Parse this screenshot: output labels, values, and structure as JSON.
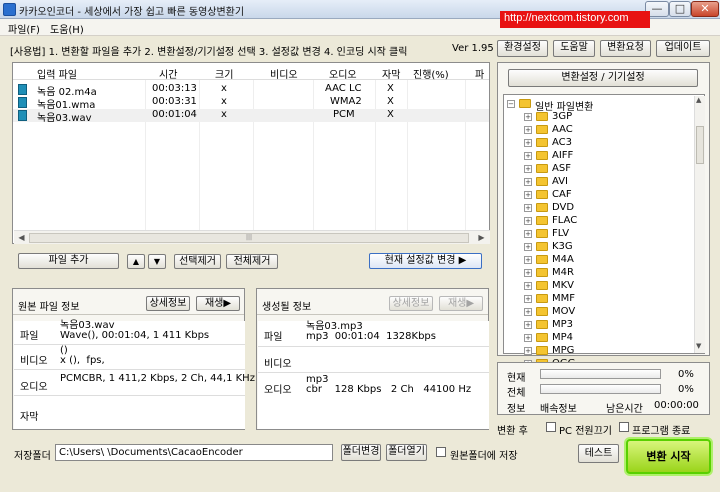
{
  "window": {
    "title": "카카오인코더 - 세상에서 가장 쉽고 빠른 동영상변환기",
    "watermark": "http://nextcom.tistory.com",
    "min": "—",
    "max": "□",
    "close": "✕"
  },
  "menu": [
    "파일(F)",
    "도움(H)"
  ],
  "instructions": "[사용법] 1. 변환할 파일을 추가   2. 변환설정/기기설정 선택   3. 설정값 변경   4. 인코딩 시작 클릭",
  "version": "Ver 1.95",
  "top_buttons": [
    "환경설정",
    "도움말",
    "변환요청",
    "업데이트"
  ],
  "file_table": {
    "columns": [
      "입력 파일",
      "시간",
      "크기",
      "비디오",
      "오디오",
      "자막",
      "진행(%)",
      "파"
    ],
    "rows": [
      {
        "name": "녹음 02.m4a",
        "time": "00:03:13",
        "size": "x",
        "video": "",
        "audio": "AAC LC",
        "sub": "X",
        "progress": ""
      },
      {
        "name": "녹음01.wma",
        "time": "00:03:31",
        "size": "x",
        "video": "",
        "audio": "WMA2",
        "sub": "X",
        "progress": ""
      },
      {
        "name": "녹음03.wav",
        "time": "00:01:04",
        "size": "x",
        "video": "",
        "audio": "PCM",
        "sub": "X",
        "progress": ""
      }
    ]
  },
  "file_buttons": {
    "add": "파일 추가",
    "up": "▲",
    "down": "▼",
    "remove_selected": "선택제거",
    "remove_all": "전체제거",
    "change_settings": "현재 설정값 변경 ▶"
  },
  "source_info": {
    "title": "원본 파일 정보",
    "detail": "상세정보",
    "play": "재생▶",
    "labels": [
      "파일",
      "비디오",
      "오디오",
      "자막"
    ],
    "file": "녹음03.wav\nWave(), 00:01:04, 1 411 Kbps",
    "video": "()\nx (),  fps,",
    "audio": "PCMCBR, 1 411,2 Kbps, 2 Ch, 44,1 KHz",
    "sub": ""
  },
  "output_info": {
    "title": "생성될 정보",
    "detail": "상세정보",
    "play": "재생▶",
    "labels": [
      "파일",
      "비디오",
      "오디오"
    ],
    "file": "녹음03.mp3\nmp3  00:01:04  1328Kbps",
    "video": "",
    "audio": "mp3\ncbr    128 Kbps   2 Ch   44100 Hz"
  },
  "tree": {
    "title": "변환설정 / 기기설정",
    "root": "일반 파일변환",
    "items": [
      "3GP",
      "AAC",
      "AC3",
      "AIFF",
      "ASF",
      "AVI",
      "CAF",
      "DVD",
      "FLAC",
      "FLV",
      "K3G",
      "M4A",
      "M4R",
      "MKV",
      "MMF",
      "MOV",
      "MP3",
      "MP4",
      "MPG",
      "OGG"
    ]
  },
  "progress": {
    "current_label": "현재",
    "current_value": 0,
    "current_text": "0%",
    "total_label": "전체",
    "total_value": 0,
    "total_text": "0%",
    "info_label": "정보",
    "speed_label": "배속정보",
    "remain_label": "남은시간",
    "remain_value": "00:00:00"
  },
  "after": {
    "label": "변환 후",
    "shutdown": "PC 전원끄기",
    "exit": "프로그램 종료"
  },
  "save": {
    "label": "저장폴더",
    "path": "C:\\Users\\      \\Documents\\CacaoEncoder",
    "change": "폴더변경",
    "open": "폴더열기",
    "same_folder": "원본폴더에 저장"
  },
  "test_button": "테스트",
  "start_button": "변환 시작",
  "colors": {
    "start_bg": "#a6e22e",
    "start_border": "#58d000",
    "watermark": "#e81212"
  }
}
